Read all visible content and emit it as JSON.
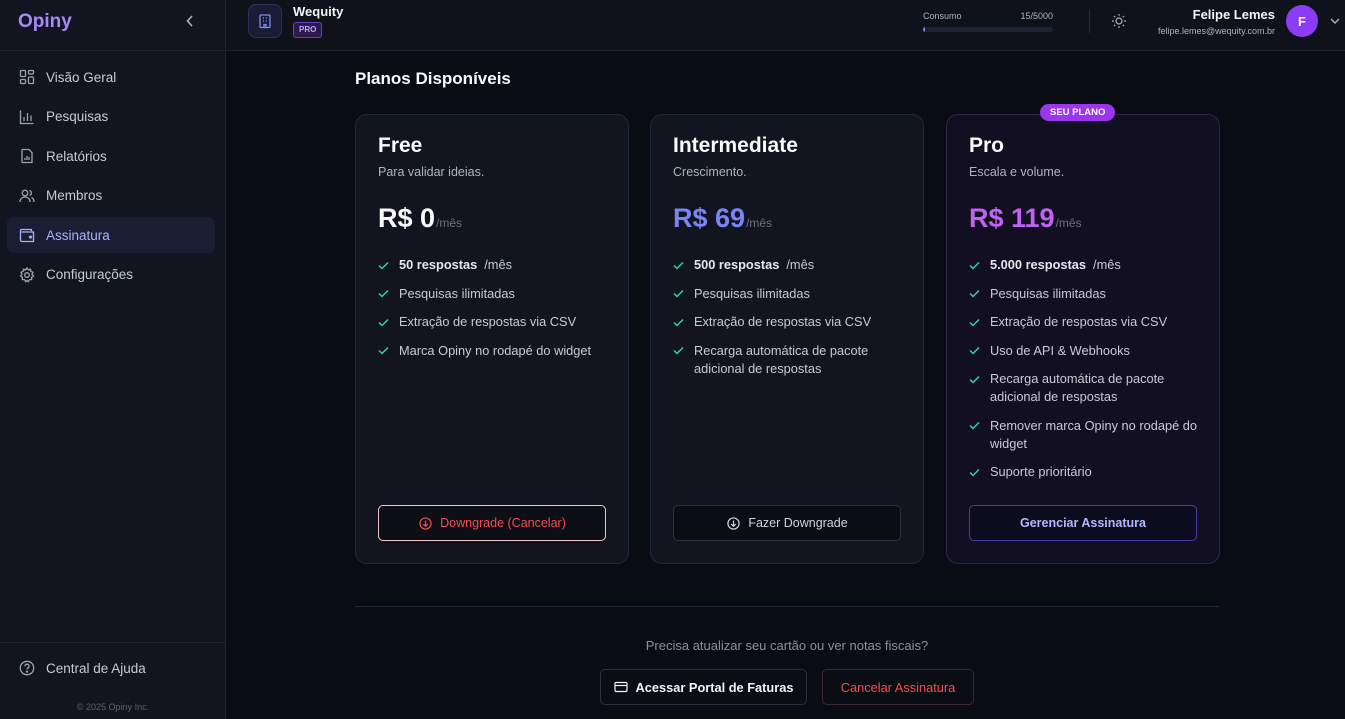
{
  "app": {
    "brand": "Opiny",
    "copyright": "© 2025 Opiny Inc."
  },
  "sidebar": {
    "items": [
      {
        "label": "Visão Geral",
        "icon": "grid-icon",
        "active": false
      },
      {
        "label": "Pesquisas",
        "icon": "bar-chart-icon",
        "active": false
      },
      {
        "label": "Relatórios",
        "icon": "report-icon",
        "active": false
      },
      {
        "label": "Membros",
        "icon": "users-icon",
        "active": false
      },
      {
        "label": "Assinatura",
        "icon": "wallet-icon",
        "active": true
      },
      {
        "label": "Configurações",
        "icon": "gear-icon",
        "active": false
      }
    ],
    "help": "Central de Ajuda"
  },
  "header": {
    "org_name": "Wequity",
    "org_badge": "PRO",
    "usage_label": "Consumo",
    "usage_count": "15/5000",
    "usage_fraction": 0.003,
    "user_name": "Felipe Lemes",
    "user_email": "felipe.lemes@wequity.com.br",
    "avatar_initial": "F"
  },
  "main": {
    "title": "Planos Disponíveis",
    "current_badge": "SEU PLANO",
    "plans": [
      {
        "name": "Free",
        "desc": "Para validar ideias.",
        "price": "R$ 0",
        "unit": "/mês",
        "price_color": "#f9fafb",
        "features": [
          {
            "bold": "50 respostas",
            "text": "/mês"
          },
          {
            "bold": "",
            "text": "Pesquisas ilimitadas"
          },
          {
            "bold": "",
            "text": "Extração de respostas via CSV"
          },
          {
            "bold": "",
            "text": "Marca Opiny no rodapé do widget"
          }
        ],
        "button": "Downgrade (Cancelar)"
      },
      {
        "name": "Intermediate",
        "desc": "Crescimento.",
        "price": "R$ 69",
        "unit": "/mês",
        "price_color": "#7b84f6",
        "features": [
          {
            "bold": "500 respostas",
            "text": "/mês"
          },
          {
            "bold": "",
            "text": "Pesquisas ilimitadas"
          },
          {
            "bold": "",
            "text": "Extração de respostas via CSV"
          },
          {
            "bold": "",
            "text": "Recarga automática de pacote adicional de respostas"
          }
        ],
        "button": "Fazer Downgrade"
      },
      {
        "name": "Pro",
        "desc": "Escala e volume.",
        "price": "R$ 119",
        "unit": "/mês",
        "price_color": "#c062f2",
        "features": [
          {
            "bold": "5.000 respostas",
            "text": "/mês"
          },
          {
            "bold": "",
            "text": "Pesquisas ilimitadas"
          },
          {
            "bold": "",
            "text": "Extração de respostas via CSV"
          },
          {
            "bold": "",
            "text": "Uso de API & Webhooks"
          },
          {
            "bold": "",
            "text": "Recarga automática de pacote adicional de respostas"
          },
          {
            "bold": "",
            "text": "Remover marca Opiny no rodapé do widget"
          },
          {
            "bold": "",
            "text": "Suporte prioritário"
          }
        ],
        "button": "Gerenciar Assinatura"
      }
    ],
    "billing_prompt": "Precisa atualizar seu cartão ou ver notas fiscais?",
    "portal_button": "Acessar Portal de Faturas",
    "cancel_button": "Cancelar Assinatura"
  },
  "colors": {
    "accent": "#a78bfa",
    "check": "#34d399",
    "danger": "#f44d4d",
    "badge": "#9b36ef"
  }
}
